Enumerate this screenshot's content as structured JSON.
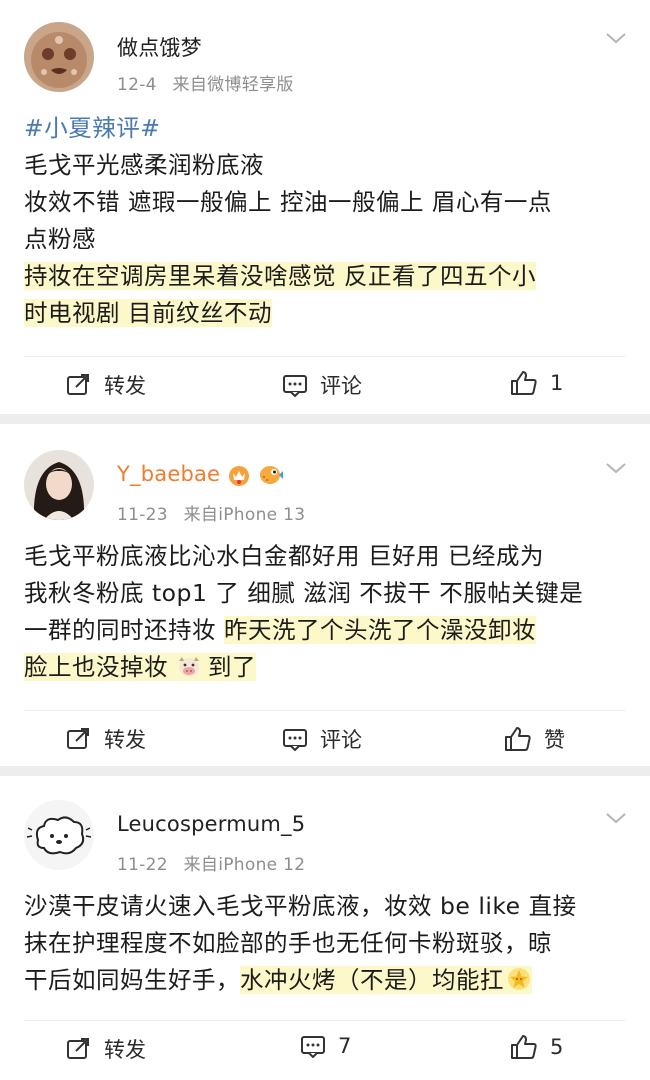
{
  "posts": [
    {
      "username": "做点饿梦",
      "date": "12-4",
      "source": "来自微博轻享版",
      "hashtag": "#小夏辣评#",
      "lines": [
        "毛戈平光感柔润粉底液",
        "妆效不错 遮瑕一般偏上 控油一般偏上 眉心有一点",
        "点粉感"
      ],
      "highlight_lines": [
        "持妆在空调房里呆着没啥感觉 反正看了四五个小",
        "时电视剧 目前纹丝不动"
      ],
      "actions": {
        "repost": "转发",
        "comment": "评论",
        "like": "1"
      }
    },
    {
      "username": "Y_baebae",
      "date": "11-23",
      "source": "来自iPhone 13",
      "line1": "毛戈平粉底液比沁水白金都好用 巨好用 已经成为",
      "line2": "我秋冬粉底 top1 了 细腻 滋润 不拔干 不服帖关键是",
      "line3_plain": "一群的同时还持妆 ",
      "line3_hl": "昨天洗了个头洗了个澡没卸妆",
      "line4_hl_a": "脸上也没掉妆 ",
      "line4_hl_b": "到了",
      "actions": {
        "repost": "转发",
        "comment": "评论",
        "like": "赞"
      }
    },
    {
      "username": "Leucospermum_5",
      "date": "11-22",
      "source": "来自iPhone 12",
      "line1": "沙漠干皮请火速入毛戈平粉底液，妆效 be like 直接",
      "line2": "抹在护理程度不如脸部的手也无任何卡粉斑驳，晾",
      "line3_plain": "干后如同妈生好手，",
      "line3_hl": "水冲火烤（不是）均能扛",
      "actions": {
        "repost": "转发",
        "comment": "7",
        "like": "5"
      }
    }
  ],
  "colors": {
    "highlight": "#fdf8c9",
    "hashtag": "#4a78b0",
    "username_vip": "#f07c2e",
    "meta": "#8e8e8e"
  },
  "icons": [
    "chevron-down-icon",
    "repost-icon",
    "comment-icon",
    "like-icon",
    "vip-crown-icon",
    "pufferfish-icon",
    "cow-emoji-icon",
    "star-emoji-icon"
  ]
}
